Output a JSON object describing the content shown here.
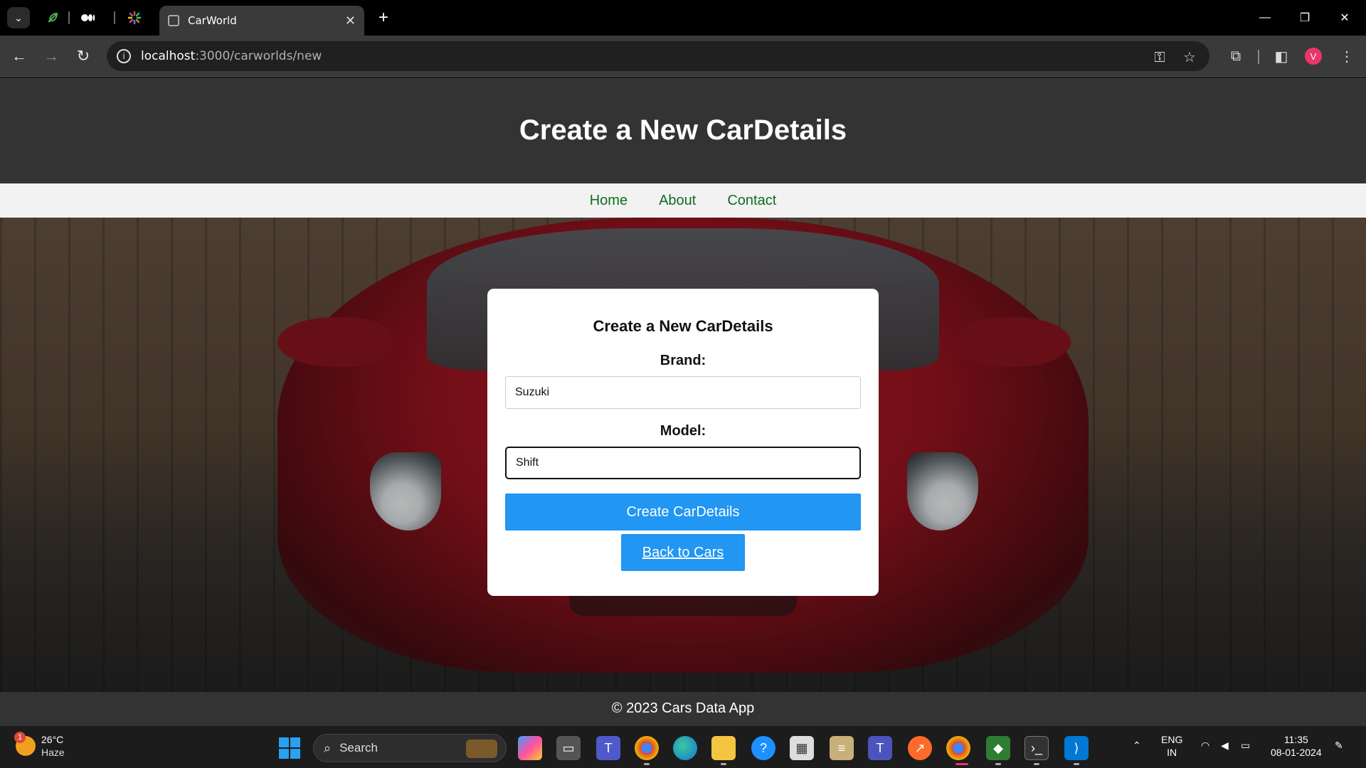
{
  "browser": {
    "tab_title": "CarWorld",
    "tab_close": "✕",
    "new_tab": "+",
    "url_host": "localhost",
    "url_path": ":3000/carworlds/new",
    "profile_initial": "V"
  },
  "page": {
    "header_title": "Create a New CarDetails",
    "nav": [
      "Home",
      "About",
      "Contact"
    ],
    "form": {
      "title": "Create a New CarDetails",
      "brand_label": "Brand:",
      "brand_value": "Suzuki",
      "model_label": "Model:",
      "model_value": "Shift",
      "submit_label": "Create CarDetails",
      "back_label": "Back to Cars"
    },
    "footer": "© 2023 Cars Data App"
  },
  "taskbar": {
    "weather_temp": "26°C",
    "weather_cond": "Haze",
    "weather_badge": "1",
    "search_label": "Search",
    "lang_1": "ENG",
    "lang_2": "IN",
    "time": "11:35",
    "date": "08-01-2024"
  },
  "colors": {
    "header_bg": "#333333",
    "nav_link": "#0d6e1e",
    "button": "#2196f3"
  }
}
